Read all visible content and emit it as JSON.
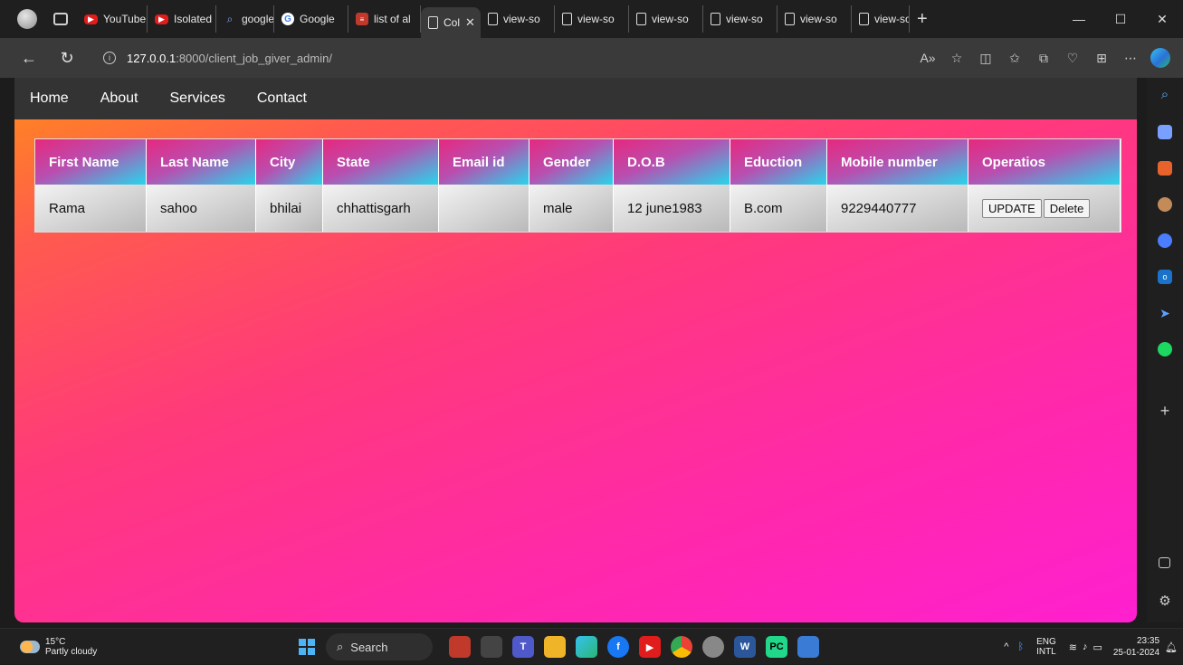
{
  "browser": {
    "tabs": [
      {
        "label": "YouTube",
        "icon": "youtube-icon"
      },
      {
        "label": "Isolated",
        "icon": "youtube-icon"
      },
      {
        "label": "google",
        "icon": "search-icon"
      },
      {
        "label": "Google",
        "icon": "google-icon"
      },
      {
        "label": "list of al",
        "icon": "list-icon"
      },
      {
        "label": "Col",
        "icon": "document-icon",
        "active": true
      },
      {
        "label": "view-so",
        "icon": "document-icon"
      },
      {
        "label": "view-so",
        "icon": "document-icon"
      },
      {
        "label": "view-so",
        "icon": "document-icon"
      },
      {
        "label": "view-so",
        "icon": "document-icon"
      },
      {
        "label": "view-so",
        "icon": "document-icon"
      },
      {
        "label": "view-so",
        "icon": "document-icon"
      }
    ],
    "url_host": "127.0.0.1",
    "url_path": ":8000/client_job_giver_admin/"
  },
  "nav": {
    "home": "Home",
    "about": "About",
    "services": "Services",
    "contact": "Contact"
  },
  "table": {
    "headers": [
      "First Name",
      "Last Name",
      "City",
      "State",
      "Email id",
      "Gender",
      "D.O.B",
      "Eduction",
      "Mobile number",
      "Operatios"
    ],
    "row": {
      "first_name": "Rama",
      "last_name": "sahoo",
      "city": "bhilai",
      "state": "chhattisgarh",
      "email": "",
      "gender": "male",
      "dob": "12 june1983",
      "education": "B.com",
      "mobile": "9229440777",
      "update_label": "UPDATE",
      "delete_label": "Delete"
    }
  },
  "taskbar": {
    "temperature": "15°C",
    "weather": "Partly cloudy",
    "search_label": "Search",
    "lang_1": "ENG",
    "lang_2": "INTL",
    "time": "23:35",
    "date": "25-01-2024"
  },
  "colors": {
    "navbar_bg": "#333333",
    "header_gradient_start": "#e6287e",
    "header_gradient_end": "#27d6ec",
    "page_gradient_start": "#ff8c1a",
    "page_gradient_end": "#ff1fd0"
  }
}
